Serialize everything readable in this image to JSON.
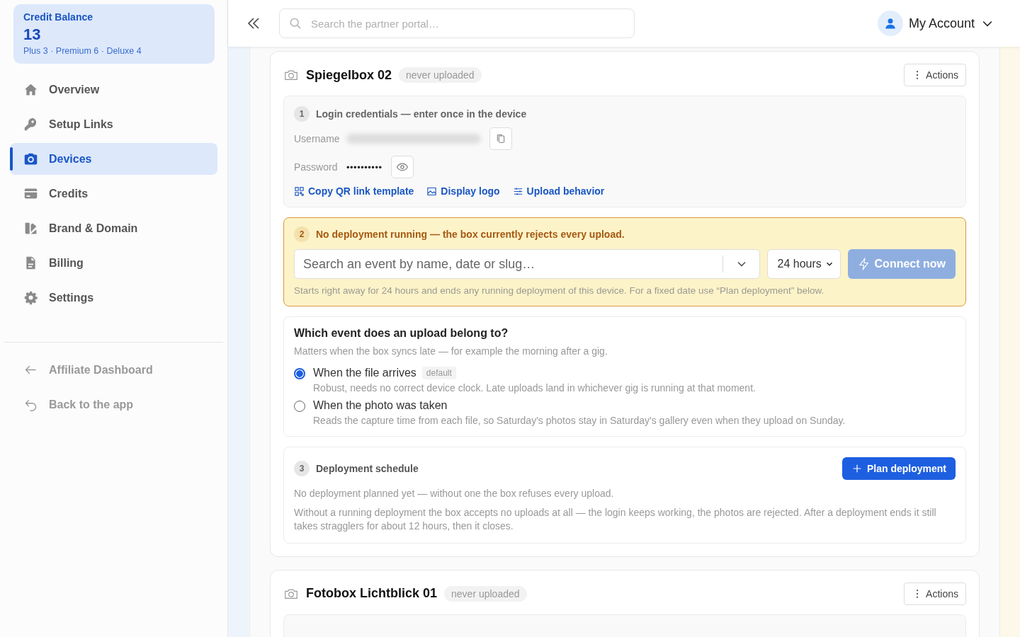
{
  "sidebar": {
    "credit": {
      "label": "Credit Balance",
      "value": "13",
      "breakdown": "Plus 3 · Premium 6 · Deluxe 4"
    },
    "nav": [
      {
        "label": "Overview",
        "selected": false
      },
      {
        "label": "Setup Links",
        "selected": false
      },
      {
        "label": "Devices",
        "selected": true
      },
      {
        "label": "Credits",
        "selected": false
      },
      {
        "label": "Brand & Domain",
        "selected": false
      },
      {
        "label": "Billing",
        "selected": false
      },
      {
        "label": "Settings",
        "selected": false
      }
    ],
    "footer_links": [
      {
        "label": "Affiliate Dashboard"
      },
      {
        "label": "Back to the app"
      }
    ]
  },
  "header": {
    "search": {
      "placeholder": "Search the partner portal…"
    },
    "account": "My Account"
  },
  "devices": [
    {
      "name": "Spiegelbox 02",
      "status": "never uploaded",
      "actions": "Actions",
      "credentials": {
        "step": "1",
        "title": "Login credentials — enter once in the device",
        "username_label": "Username",
        "password_label": "Password",
        "password_value": "••••••••••",
        "links": [
          {
            "label": "Copy QR link template"
          },
          {
            "label": "Display logo"
          },
          {
            "label": "Upload behavior"
          }
        ]
      },
      "deployment": {
        "step": "2",
        "message": "No deployment running — the box currently rejects every upload.",
        "event_placeholder": "Search an event by name, date or slug…",
        "duration": "24 hours",
        "connect": {
          "label": "Connect now",
          "disabled": true
        },
        "hint": "Starts right away for 24 hours and ends any running deployment of this device. For a fixed date use “Plan deployment” below."
      },
      "assignment": {
        "title": "Which event does an upload belong to?",
        "subtitle": "Matters when the box syncs late — for example the morning after a gig.",
        "options": [
          {
            "label": "When the file arrives",
            "badge": "default",
            "description": "Robust, needs no correct device clock. Late uploads land in whichever gig is running at that moment.",
            "selected": true
          },
          {
            "label": "When the photo was taken",
            "description": "Reads the capture time from each file, so Saturday's photos stay in Saturday's gallery even when they upload on Sunday.",
            "selected": false
          }
        ]
      },
      "schedule": {
        "step": "3",
        "title": "Deployment schedule",
        "button": "Plan deployment",
        "empty": "No deployment planned yet — without one the box refuses every upload.",
        "note": "Without a running deployment the box accepts no uploads at all — the login keeps working, the photos are rejected. After a deployment ends it still takes stragglers for about 12 hours, then it closes."
      }
    },
    {
      "name": "Fotobox Lichtblick 01",
      "status": "never uploaded",
      "actions": "Actions"
    }
  ]
}
